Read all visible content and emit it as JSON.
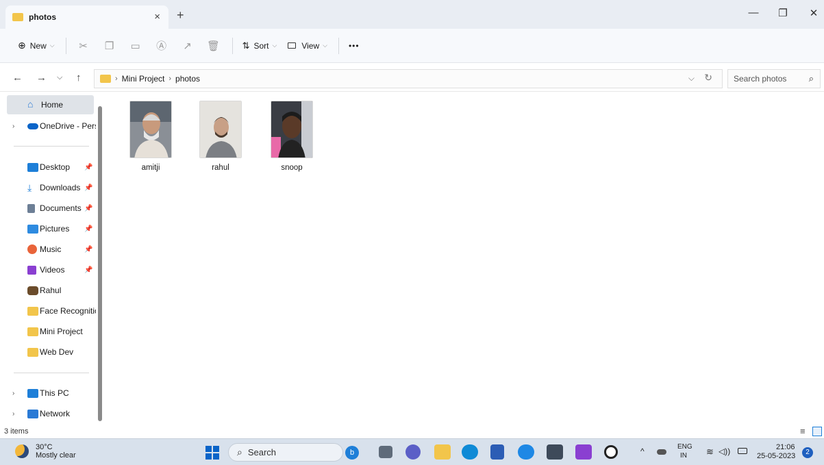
{
  "window": {
    "tab_title": "photos",
    "tab_close": "×",
    "new_tab": "+",
    "minimize": "—",
    "restore": "❐",
    "close": "✕"
  },
  "toolbar": {
    "new_label": "New",
    "sort_label": "Sort",
    "view_label": "View",
    "more_label": "•••"
  },
  "address": {
    "crumbs": [
      "Mini Project",
      "photos"
    ],
    "search_placeholder": "Search photos"
  },
  "sidebar": {
    "home": "Home",
    "onedrive": "OneDrive - Perso",
    "pinned": [
      {
        "label": "Desktop"
      },
      {
        "label": "Downloads"
      },
      {
        "label": "Documents"
      },
      {
        "label": "Pictures"
      },
      {
        "label": "Music"
      },
      {
        "label": "Videos"
      }
    ],
    "user": "Rahul",
    "folders": [
      "Face Recognitior",
      "Mini Project",
      "Web Dev"
    ],
    "this_pc": "This PC",
    "network": "Network"
  },
  "files": [
    {
      "name": "amitji"
    },
    {
      "name": "rahul"
    },
    {
      "name": "snoop"
    }
  ],
  "status": {
    "count": "3 items"
  },
  "taskbar": {
    "temperature": "30°C",
    "condition": "Mostly clear",
    "search_label": "Search",
    "lang_top": "ENG",
    "lang_bottom": "IN",
    "time": "21:06",
    "date": "25-05-2023",
    "notification_count": "2"
  },
  "colors": {
    "folder": "#f2c54b",
    "accent": "#0a64c8",
    "selection": "#dfe3e8"
  }
}
